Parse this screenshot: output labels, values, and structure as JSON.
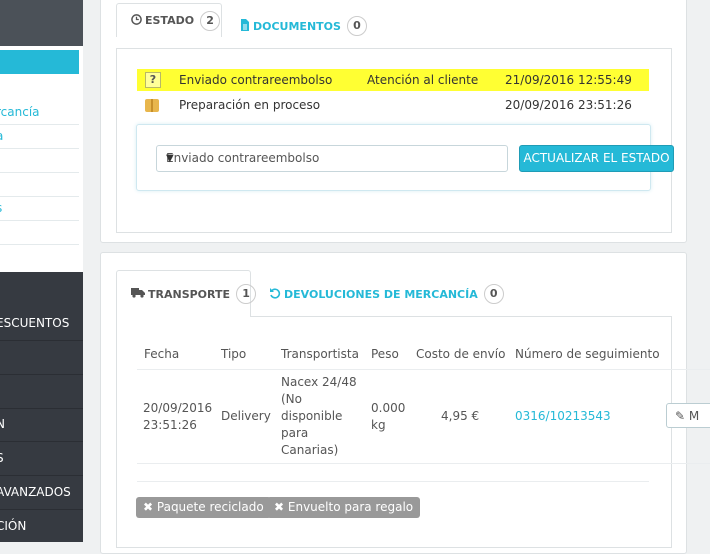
{
  "sidebar": {
    "sub_items": [
      "rcancía",
      "a",
      "",
      "",
      "s",
      ""
    ],
    "menu_items": [
      "ESCUENTOS",
      "",
      "",
      "N",
      "S",
      "AVANZADOS",
      "CIÓN"
    ]
  },
  "status_panel": {
    "tabs": [
      {
        "label": "ESTADO",
        "count": "2",
        "icon": "clock-icon"
      },
      {
        "label": "DOCUMENTOS",
        "count": "0",
        "icon": "file-icon"
      }
    ],
    "history": [
      {
        "status": "Enviado contrareembolso",
        "employee": "Atención al cliente",
        "date": "21/09/2016 12:55:49",
        "icon": "question-icon"
      },
      {
        "status": "Preparación en proceso",
        "employee": "",
        "date": "20/09/2016 23:51:26",
        "icon": "box-icon"
      }
    ],
    "select_value": "Enviado contrareembolso",
    "update_button": "ACTUALIZAR EL ESTADO"
  },
  "shipping_panel": {
    "tabs": [
      {
        "label": "TRANSPORTE",
        "count": "1",
        "icon": "truck-icon"
      },
      {
        "label": "DEVOLUCIONES DE MERCANCÍA",
        "count": "0",
        "icon": "undo-icon"
      }
    ],
    "columns": [
      "Fecha",
      "Tipo",
      "Transportista",
      "Peso",
      "Costo de envío",
      "Número de seguimiento"
    ],
    "row": {
      "date": "20/09/2016 23:51:26",
      "type": "Delivery",
      "carrier": "Nacex 24/48 (No disponible para Canarias)",
      "weight": "0.000 kg",
      "cost": "4,95 €",
      "tracking": "0316/10213543",
      "edit_label": "M"
    },
    "buttons": [
      "Paquete reciclado",
      "Envuelto para regalo"
    ]
  },
  "colors": {
    "accent": "#25b9d7",
    "highlight": "#ffff33",
    "sidebar": "#363a41"
  }
}
